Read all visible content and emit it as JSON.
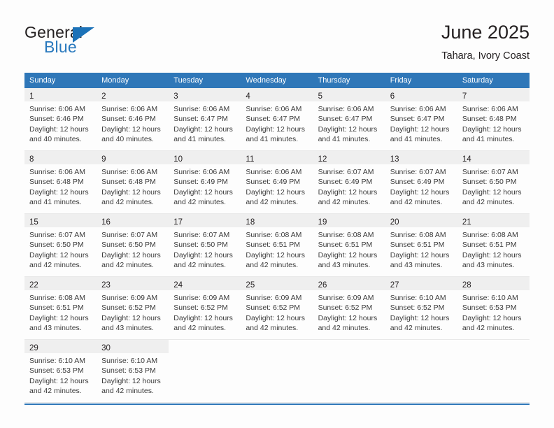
{
  "brand": {
    "name_top": "General",
    "name_bottom": "Blue",
    "flag_icon": "triangle-flag-icon",
    "accent_color": "#2878bd"
  },
  "header": {
    "title": "June 2025",
    "subtitle": "Tahara, Ivory Coast"
  },
  "theme": {
    "header_row_color": "#2f77b8",
    "daynum_row_color": "#efefef",
    "page_background": "#fdfdfd",
    "text_color": "#231f20"
  },
  "calendar": {
    "weekday_headers": [
      "Sunday",
      "Monday",
      "Tuesday",
      "Wednesday",
      "Thursday",
      "Friday",
      "Saturday"
    ],
    "weeks": [
      [
        {
          "day": "1",
          "sunrise": "Sunrise: 6:06 AM",
          "sunset": "Sunset: 6:46 PM",
          "daylight_1": "Daylight: 12 hours",
          "daylight_2": "and 40 minutes."
        },
        {
          "day": "2",
          "sunrise": "Sunrise: 6:06 AM",
          "sunset": "Sunset: 6:46 PM",
          "daylight_1": "Daylight: 12 hours",
          "daylight_2": "and 40 minutes."
        },
        {
          "day": "3",
          "sunrise": "Sunrise: 6:06 AM",
          "sunset": "Sunset: 6:47 PM",
          "daylight_1": "Daylight: 12 hours",
          "daylight_2": "and 41 minutes."
        },
        {
          "day": "4",
          "sunrise": "Sunrise: 6:06 AM",
          "sunset": "Sunset: 6:47 PM",
          "daylight_1": "Daylight: 12 hours",
          "daylight_2": "and 41 minutes."
        },
        {
          "day": "5",
          "sunrise": "Sunrise: 6:06 AM",
          "sunset": "Sunset: 6:47 PM",
          "daylight_1": "Daylight: 12 hours",
          "daylight_2": "and 41 minutes."
        },
        {
          "day": "6",
          "sunrise": "Sunrise: 6:06 AM",
          "sunset": "Sunset: 6:47 PM",
          "daylight_1": "Daylight: 12 hours",
          "daylight_2": "and 41 minutes."
        },
        {
          "day": "7",
          "sunrise": "Sunrise: 6:06 AM",
          "sunset": "Sunset: 6:48 PM",
          "daylight_1": "Daylight: 12 hours",
          "daylight_2": "and 41 minutes."
        }
      ],
      [
        {
          "day": "8",
          "sunrise": "Sunrise: 6:06 AM",
          "sunset": "Sunset: 6:48 PM",
          "daylight_1": "Daylight: 12 hours",
          "daylight_2": "and 41 minutes."
        },
        {
          "day": "9",
          "sunrise": "Sunrise: 6:06 AM",
          "sunset": "Sunset: 6:48 PM",
          "daylight_1": "Daylight: 12 hours",
          "daylight_2": "and 42 minutes."
        },
        {
          "day": "10",
          "sunrise": "Sunrise: 6:06 AM",
          "sunset": "Sunset: 6:49 PM",
          "daylight_1": "Daylight: 12 hours",
          "daylight_2": "and 42 minutes."
        },
        {
          "day": "11",
          "sunrise": "Sunrise: 6:06 AM",
          "sunset": "Sunset: 6:49 PM",
          "daylight_1": "Daylight: 12 hours",
          "daylight_2": "and 42 minutes."
        },
        {
          "day": "12",
          "sunrise": "Sunrise: 6:07 AM",
          "sunset": "Sunset: 6:49 PM",
          "daylight_1": "Daylight: 12 hours",
          "daylight_2": "and 42 minutes."
        },
        {
          "day": "13",
          "sunrise": "Sunrise: 6:07 AM",
          "sunset": "Sunset: 6:49 PM",
          "daylight_1": "Daylight: 12 hours",
          "daylight_2": "and 42 minutes."
        },
        {
          "day": "14",
          "sunrise": "Sunrise: 6:07 AM",
          "sunset": "Sunset: 6:50 PM",
          "daylight_1": "Daylight: 12 hours",
          "daylight_2": "and 42 minutes."
        }
      ],
      [
        {
          "day": "15",
          "sunrise": "Sunrise: 6:07 AM",
          "sunset": "Sunset: 6:50 PM",
          "daylight_1": "Daylight: 12 hours",
          "daylight_2": "and 42 minutes."
        },
        {
          "day": "16",
          "sunrise": "Sunrise: 6:07 AM",
          "sunset": "Sunset: 6:50 PM",
          "daylight_1": "Daylight: 12 hours",
          "daylight_2": "and 42 minutes."
        },
        {
          "day": "17",
          "sunrise": "Sunrise: 6:07 AM",
          "sunset": "Sunset: 6:50 PM",
          "daylight_1": "Daylight: 12 hours",
          "daylight_2": "and 42 minutes."
        },
        {
          "day": "18",
          "sunrise": "Sunrise: 6:08 AM",
          "sunset": "Sunset: 6:51 PM",
          "daylight_1": "Daylight: 12 hours",
          "daylight_2": "and 42 minutes."
        },
        {
          "day": "19",
          "sunrise": "Sunrise: 6:08 AM",
          "sunset": "Sunset: 6:51 PM",
          "daylight_1": "Daylight: 12 hours",
          "daylight_2": "and 43 minutes."
        },
        {
          "day": "20",
          "sunrise": "Sunrise: 6:08 AM",
          "sunset": "Sunset: 6:51 PM",
          "daylight_1": "Daylight: 12 hours",
          "daylight_2": "and 43 minutes."
        },
        {
          "day": "21",
          "sunrise": "Sunrise: 6:08 AM",
          "sunset": "Sunset: 6:51 PM",
          "daylight_1": "Daylight: 12 hours",
          "daylight_2": "and 43 minutes."
        }
      ],
      [
        {
          "day": "22",
          "sunrise": "Sunrise: 6:08 AM",
          "sunset": "Sunset: 6:51 PM",
          "daylight_1": "Daylight: 12 hours",
          "daylight_2": "and 43 minutes."
        },
        {
          "day": "23",
          "sunrise": "Sunrise: 6:09 AM",
          "sunset": "Sunset: 6:52 PM",
          "daylight_1": "Daylight: 12 hours",
          "daylight_2": "and 43 minutes."
        },
        {
          "day": "24",
          "sunrise": "Sunrise: 6:09 AM",
          "sunset": "Sunset: 6:52 PM",
          "daylight_1": "Daylight: 12 hours",
          "daylight_2": "and 42 minutes."
        },
        {
          "day": "25",
          "sunrise": "Sunrise: 6:09 AM",
          "sunset": "Sunset: 6:52 PM",
          "daylight_1": "Daylight: 12 hours",
          "daylight_2": "and 42 minutes."
        },
        {
          "day": "26",
          "sunrise": "Sunrise: 6:09 AM",
          "sunset": "Sunset: 6:52 PM",
          "daylight_1": "Daylight: 12 hours",
          "daylight_2": "and 42 minutes."
        },
        {
          "day": "27",
          "sunrise": "Sunrise: 6:10 AM",
          "sunset": "Sunset: 6:52 PM",
          "daylight_1": "Daylight: 12 hours",
          "daylight_2": "and 42 minutes."
        },
        {
          "day": "28",
          "sunrise": "Sunrise: 6:10 AM",
          "sunset": "Sunset: 6:53 PM",
          "daylight_1": "Daylight: 12 hours",
          "daylight_2": "and 42 minutes."
        }
      ],
      [
        {
          "day": "29",
          "sunrise": "Sunrise: 6:10 AM",
          "sunset": "Sunset: 6:53 PM",
          "daylight_1": "Daylight: 12 hours",
          "daylight_2": "and 42 minutes."
        },
        {
          "day": "30",
          "sunrise": "Sunrise: 6:10 AM",
          "sunset": "Sunset: 6:53 PM",
          "daylight_1": "Daylight: 12 hours",
          "daylight_2": "and 42 minutes."
        },
        {
          "day": "",
          "sunrise": "",
          "sunset": "",
          "daylight_1": "",
          "daylight_2": ""
        },
        {
          "day": "",
          "sunrise": "",
          "sunset": "",
          "daylight_1": "",
          "daylight_2": ""
        },
        {
          "day": "",
          "sunrise": "",
          "sunset": "",
          "daylight_1": "",
          "daylight_2": ""
        },
        {
          "day": "",
          "sunrise": "",
          "sunset": "",
          "daylight_1": "",
          "daylight_2": ""
        },
        {
          "day": "",
          "sunrise": "",
          "sunset": "",
          "daylight_1": "",
          "daylight_2": ""
        }
      ]
    ]
  }
}
